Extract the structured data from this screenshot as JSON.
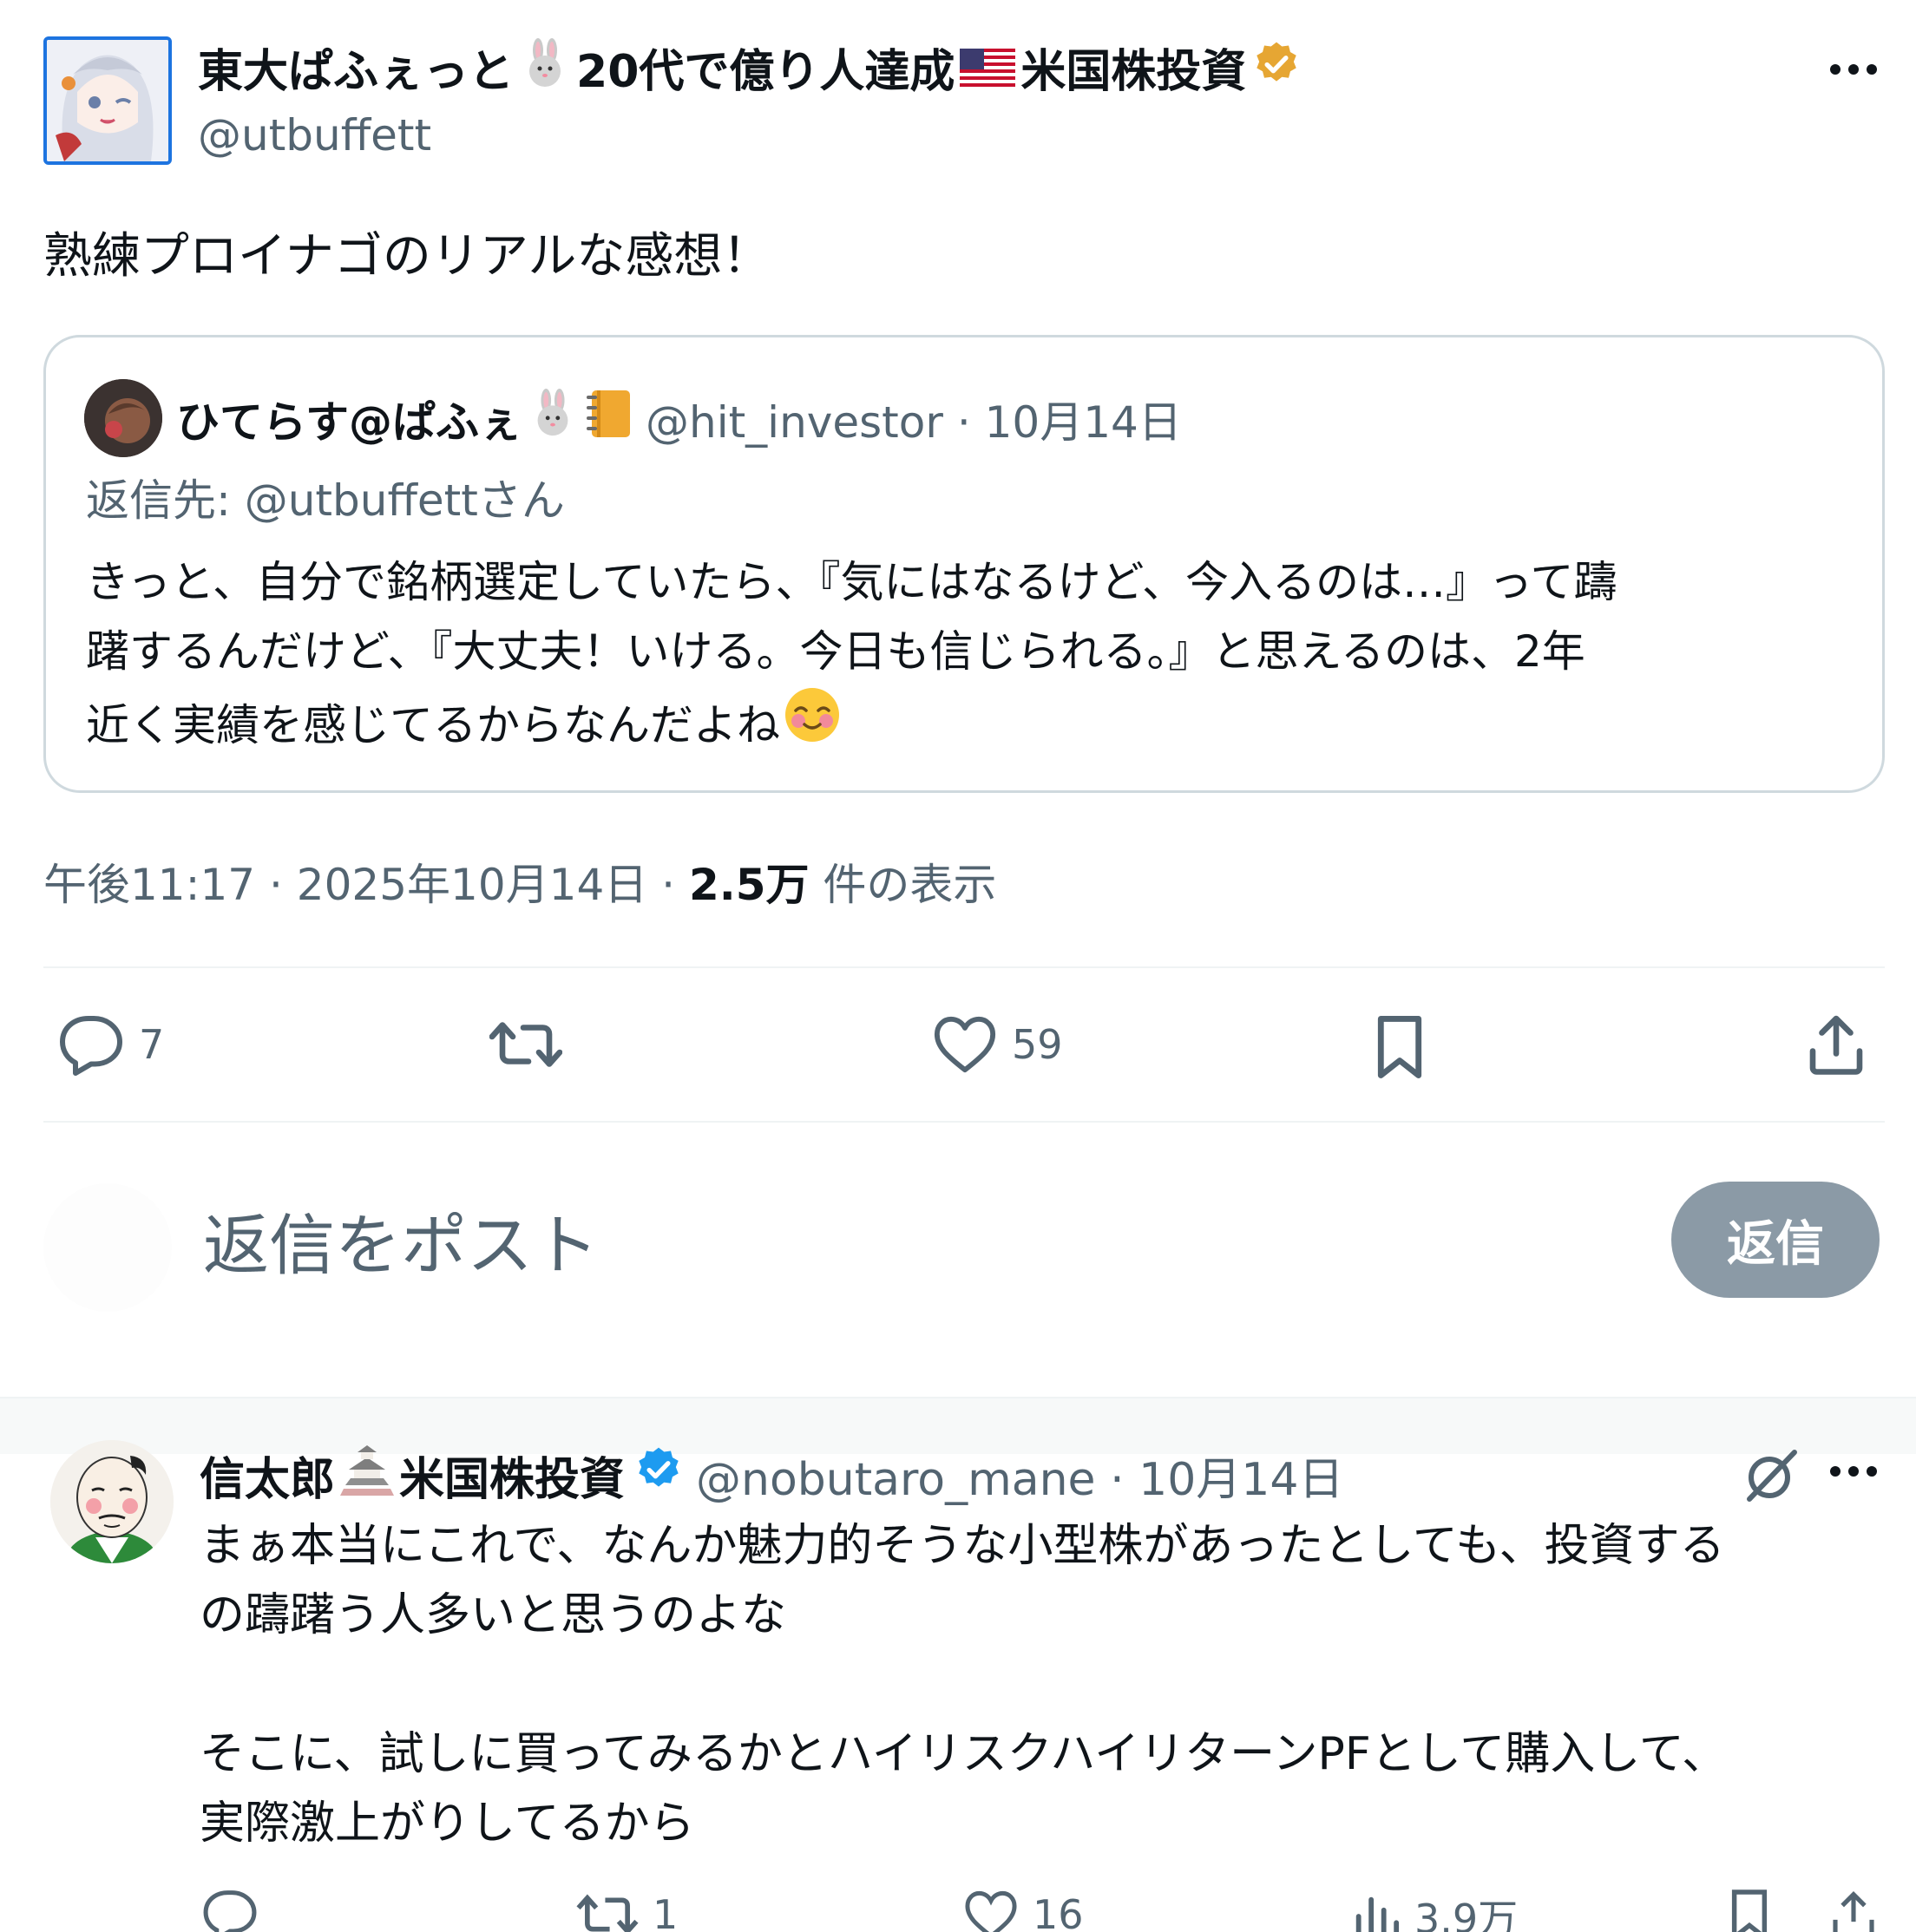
{
  "main_tweet": {
    "author_name": "東大ぱふぇっと",
    "author_name_mid": "20代で億り人達成",
    "author_name_end": "米国株投資",
    "handle": "@utbuffett",
    "text": "熟練プロイナゴのリアルな感想！",
    "time": "午後11:17 · 2025年10月14日 · ",
    "views_count": "2.5万",
    "views_label": " 件の表示",
    "verified_color": "#e6a633",
    "actions": {
      "reply_count": "7",
      "retweet_count": "",
      "like_count": "59"
    }
  },
  "quoted_tweet": {
    "author_name": "ひてらす@ぱふぇ",
    "handle_date": "@hit_investor · 10月14日",
    "reply_to": "返信先: @utbuffettさん",
    "lines": [
      "きっと、自分で銘柄選定していたら、『気にはなるけど、今入るのは…』って躊",
      "躇するんだけど、『大丈夫！いける。今日も信じられる。』と思えるのは、2年",
      "近く実績を感じてるからなんだよね"
    ]
  },
  "composer": {
    "placeholder": "返信をポスト",
    "button_label": "返信"
  },
  "reply_tweet": {
    "author_name": "信太郎",
    "author_name_end": "米国株投資",
    "handle_date": "@nobutaro_mane · 10月14日",
    "verified_color": "#1d9bf0",
    "lines": [
      "まぁ本当にこれで、なんか魅力的そうな小型株があったとしても、投資する",
      "の躊躇う人多いと思うのよな",
      "",
      "そこに、試しに買ってみるかとハイリスクハイリターンPFとして購入して、",
      "実際激上がりしてるから"
    ],
    "actions": {
      "reply_count": "",
      "retweet_count": "1",
      "like_count": "16",
      "views_count": "3.9万"
    }
  },
  "colors": {
    "text_primary": "#0f1419",
    "text_secondary": "#536471",
    "border": "#cfd9de",
    "reply_button_bg": "#8b9aa6"
  }
}
